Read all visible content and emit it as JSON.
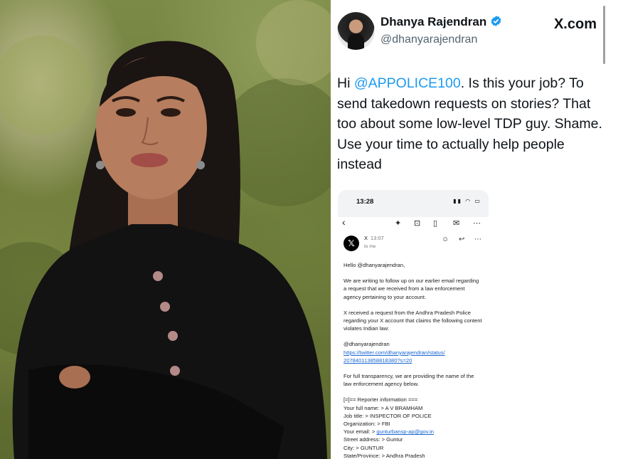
{
  "tweet": {
    "author_name": "Dhanya Rajendran",
    "author_handle": "@dhanyarajendran",
    "site_label": "X.com",
    "text_mention": "@APPOLICE100",
    "text_before": "Hi ",
    "text_after": ". Is this your job? To send takedown requests on stories? That too about some low-level TDP guy. Shame. Use your time to actually help people instead"
  },
  "phone": {
    "status_time": "13:28",
    "sender": "X",
    "sent_time": "13:07",
    "to_line": "to me",
    "greeting": "Hello @dhanyarajendran,",
    "para1": "We are writing to follow up on our earlier email regarding a request that we received from a law enforcement agency pertaining to your account.",
    "para2": "X received a request from the Andhra Pradesh Police regarding your X account that claims the following content violates Indian law:",
    "content_handle": "@dhanyarajendran",
    "content_link_1": "https://twitter.com/dhanyarajendran/status/",
    "content_link_2": "207840113858818380?s=20",
    "para3": "For full transparency, we are providing the name of the law enforcement agency below.",
    "reporter_header": "[=]== Reporter information ===",
    "full_name": "Your full name: > A V BRAMHAM",
    "job_title": "Job title: > INSPECTOR OF POLICE",
    "organization": "Organization: > FBI",
    "email_label": "Your email: > ",
    "email_value": "gunturbansp-ap@gov.in",
    "street": "Street address: > Guntur",
    "city": "City: > GUNTUR",
    "state": "State/Province: > Andhra Pradesh"
  },
  "icons": [
    "verified-badge-icon",
    "back-arrow-icon",
    "sparkle-icon",
    "archive-icon",
    "trash-icon",
    "mail-icon",
    "more-icon",
    "emoji-icon",
    "reply-icon"
  ],
  "colors": {
    "mention": "#1d9bf0",
    "verified": "#1d9bf0",
    "link": "#1a66d2"
  }
}
